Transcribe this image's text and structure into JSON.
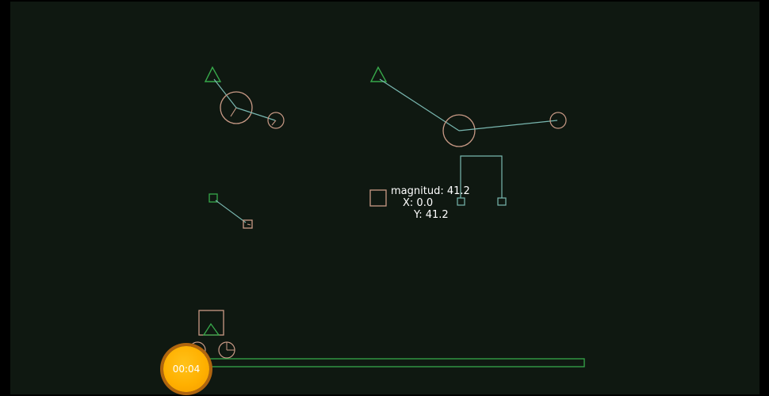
{
  "colors": {
    "background": "#0f1811",
    "green": "#37a84a",
    "peach": "#c99a86",
    "teal": "#79b7b0",
    "timer": "#ffb000"
  },
  "readout": {
    "magnitude_label": "magnitud: 41.2",
    "x_label": "X: 0.0",
    "y_label": "Y: 41.2"
  },
  "timer": {
    "time": "00:04"
  }
}
